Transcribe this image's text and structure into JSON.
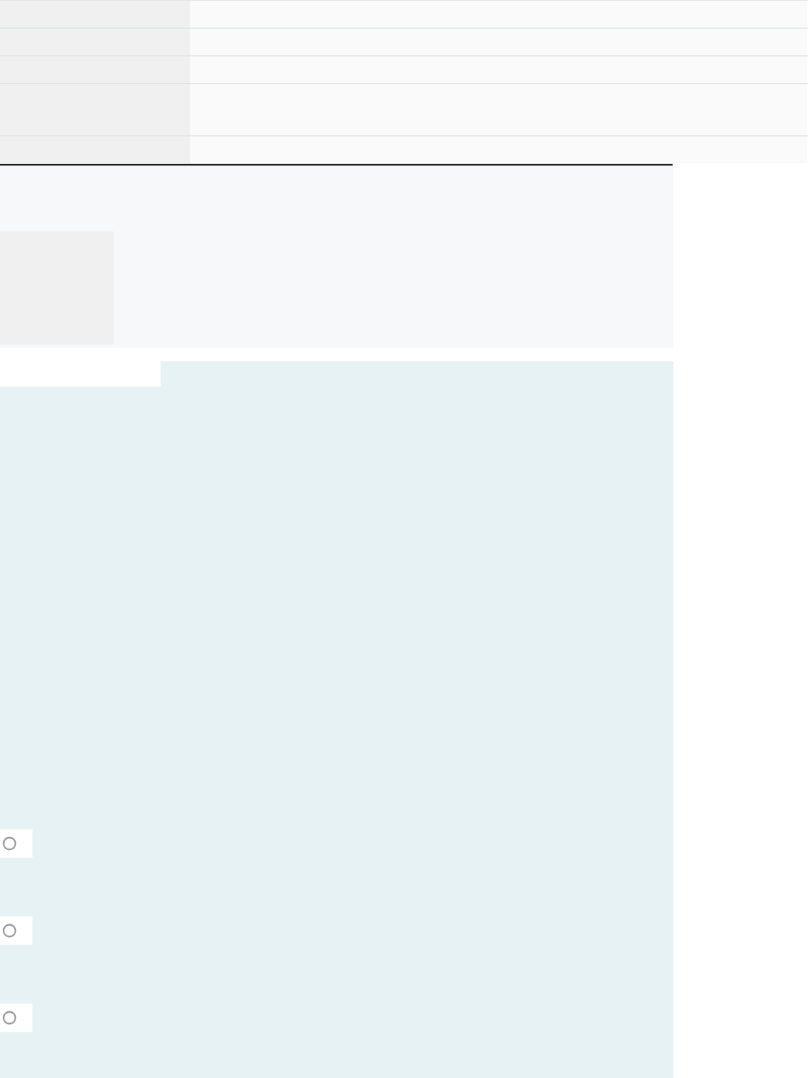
{
  "details_table": {
    "rows": [
      {
        "kind": "single"
      },
      {
        "kind": "single"
      },
      {
        "kind": "single"
      },
      {
        "kind": "double"
      },
      {
        "kind": "single"
      }
    ]
  },
  "answer_options": [
    {
      "selected": false
    },
    {
      "selected": false
    },
    {
      "selected": false
    }
  ]
}
